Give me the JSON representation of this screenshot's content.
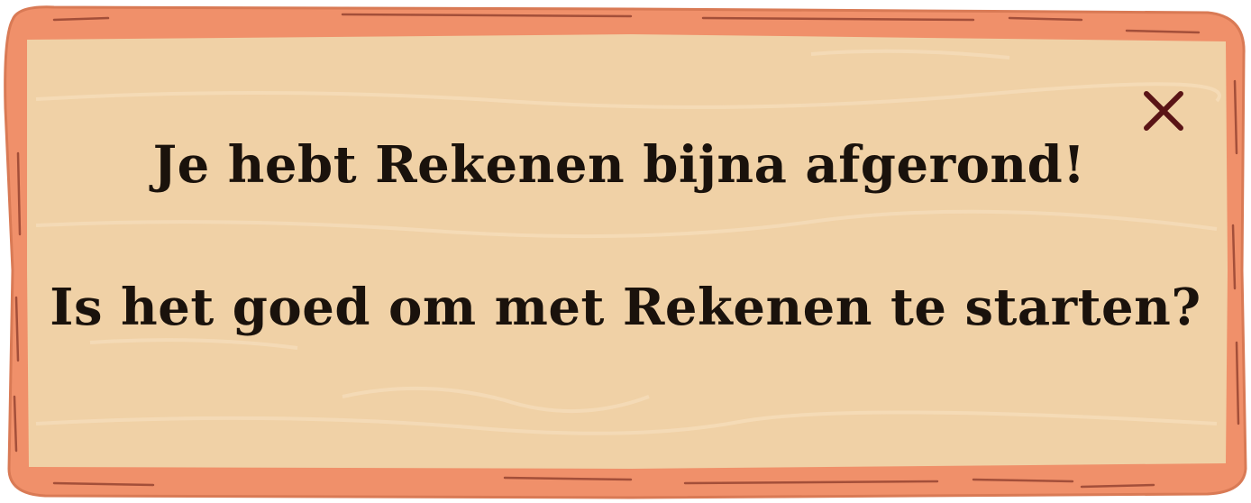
{
  "dialog": {
    "line1": "Je hebt Rekenen bijna afgerond!",
    "line2": "Is het goed om met Rekenen te starten?"
  },
  "close_icon": "close-icon",
  "colors": {
    "frame": "#f0906a",
    "frame_shadow": "#d97a55",
    "frame_grain": "#8a3a2a",
    "plank": "#f0d1a6",
    "plank_grain": "#f5dcb8",
    "text": "#1a120c",
    "close": "#5a1416"
  }
}
